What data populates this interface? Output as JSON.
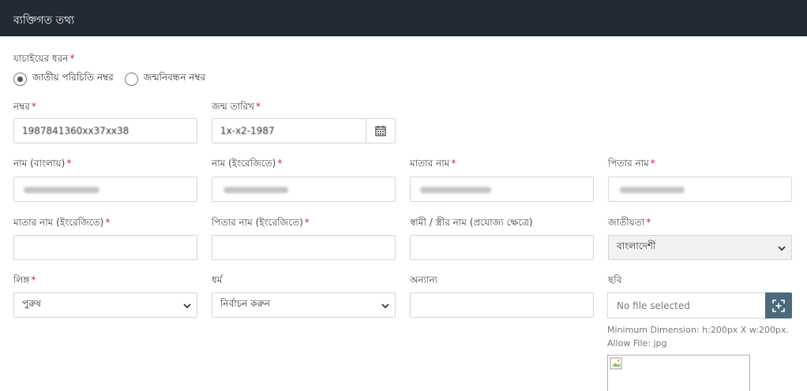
{
  "header": {
    "title": "ব্যক্তিগত তথ্য"
  },
  "verification": {
    "label": "যাচাইয়ের ধরন",
    "required": "*",
    "options": [
      {
        "label": "জাতীয় পরিচিতি নম্বর",
        "checked": true
      },
      {
        "label": "জন্মনিবন্ধন নম্বর",
        "checked": false
      }
    ]
  },
  "number_field": {
    "label": "নম্বর",
    "required": "*",
    "value": "1987841360xx37xx38"
  },
  "dob_field": {
    "label": "জন্ম তারিখ",
    "required": "*",
    "value": "1x-x2-1987",
    "icon": "calendar-icon"
  },
  "name_bn": {
    "label": "নাম (বাংলায়)",
    "required": "*"
  },
  "name_en": {
    "label": "নাম (ইংরেজিতে)",
    "required": "*"
  },
  "mother_name": {
    "label": "মাতার নাম",
    "required": "*"
  },
  "father_name": {
    "label": "পিতার নাম",
    "required": "*"
  },
  "mother_name_en": {
    "label": "মাতার নাম (ইংরেজিতে)",
    "required": "*",
    "value": ""
  },
  "father_name_en": {
    "label": "পিতার নাম (ইংরেজিতে)",
    "required": "*",
    "value": ""
  },
  "spouse_name": {
    "label": "স্বামী / স্ত্রীর নাম (প্রযোজ্য ক্ষেত্রে)",
    "value": ""
  },
  "nationality": {
    "label": "জাতীয়তা",
    "required": "*",
    "selected": "বাংলাদেশী"
  },
  "gender": {
    "label": "লিঙ্গ",
    "required": "*",
    "selected": "পুরুষ"
  },
  "religion": {
    "label": "ধর্ম",
    "selected": "নির্বাচন করুন"
  },
  "other": {
    "label": "অন্যান্য",
    "value": ""
  },
  "photo": {
    "label": "ছবি",
    "file_placeholder": "No file selected",
    "hint_dimension": "Minimum Dimension: h:200px X w:200px.",
    "hint_file": "Allow File: jpg",
    "icon": "upload-icon"
  }
}
